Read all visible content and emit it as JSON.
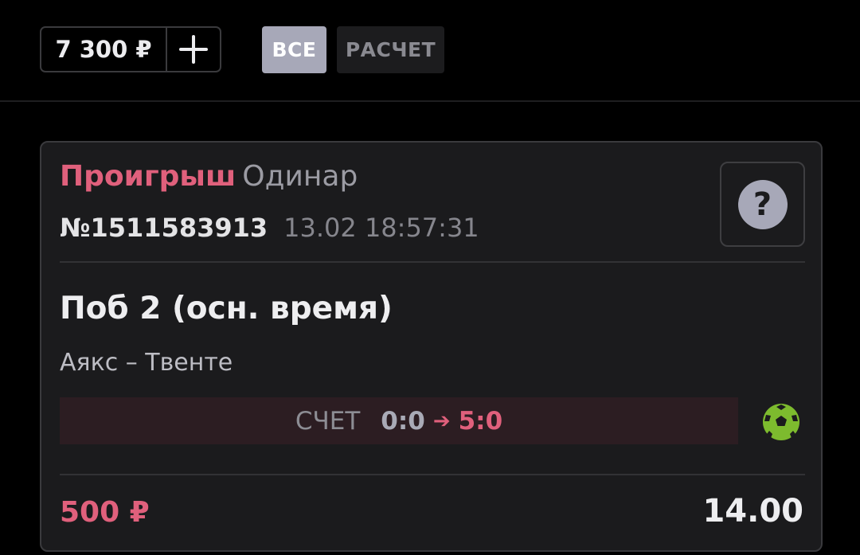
{
  "header": {
    "balance": "7 300 ₽",
    "filters": {
      "all": "ВСЕ",
      "settled": "РАСЧЕТ"
    }
  },
  "bet": {
    "status": "Проигрыш",
    "type": "Одинар",
    "number": "№1511583913",
    "datetime": "13.02 18:57:31",
    "help_symbol": "?",
    "market": "Поб 2 (осн. время)",
    "event": "Аякс – Твенте",
    "score": {
      "label": "СЧЕТ",
      "initial": "0:0",
      "arrow": "➔",
      "final": "5:0"
    },
    "sport_icon": "soccer-ball-icon",
    "stake": "500 ₽",
    "odds": "14.00"
  },
  "colors": {
    "background": "#000000",
    "card": "#1b1b1d",
    "loss_accent": "#e0607c",
    "active_filter": "#a7a8b8",
    "soccer_green": "#7dbb2e"
  }
}
